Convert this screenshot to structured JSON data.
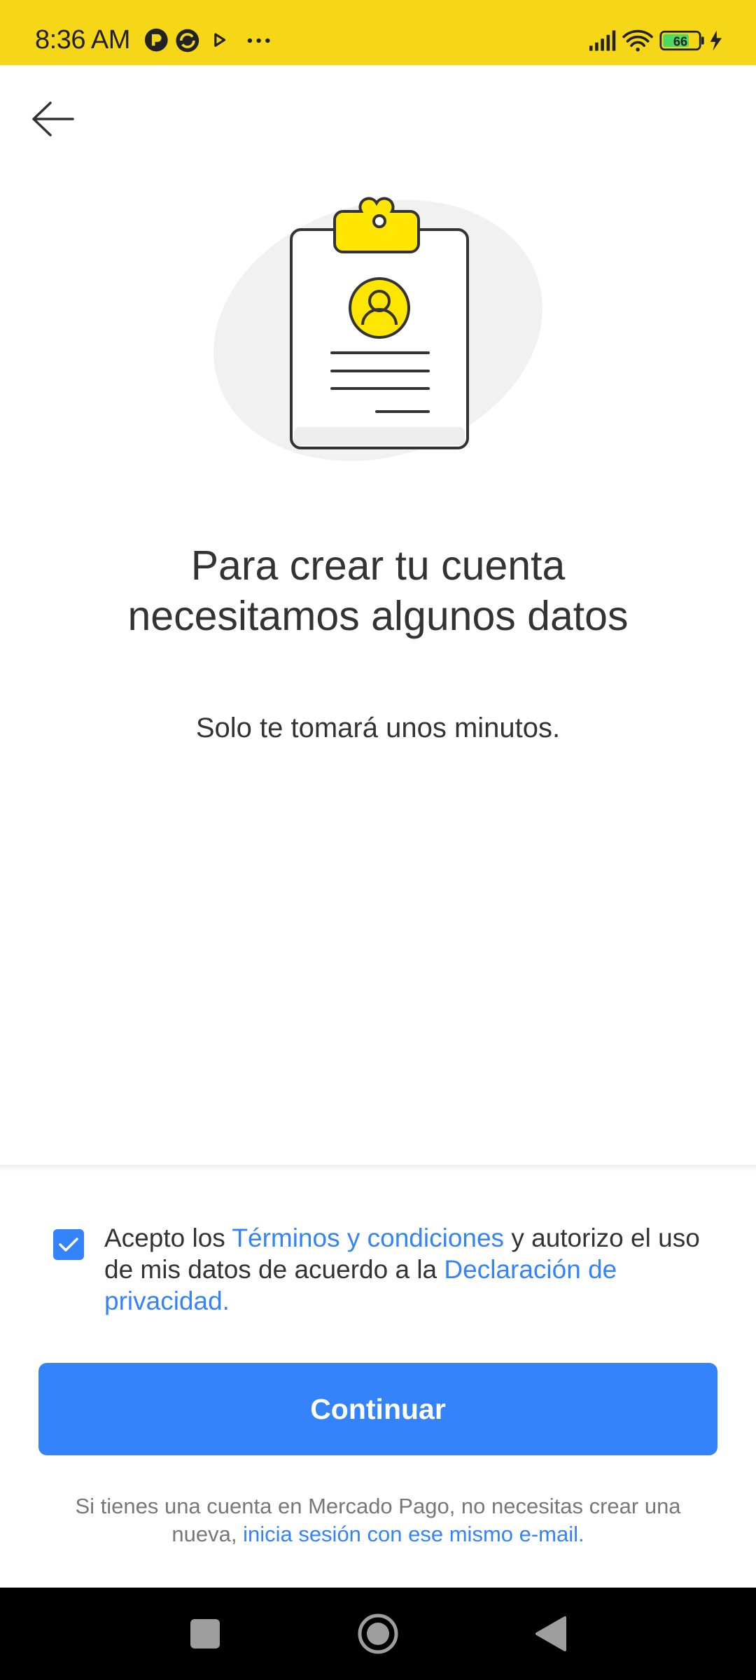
{
  "status_bar": {
    "time": "8:36 AM",
    "battery_level": "66",
    "icons": [
      "notification-icon",
      "sync-icon",
      "play-icon",
      "more-icon",
      "signal-icon",
      "wifi-icon",
      "battery-icon",
      "charging-icon"
    ]
  },
  "header": {
    "back_icon": "arrow-left-icon"
  },
  "main": {
    "illustration": "clipboard-profile-illustration",
    "title_line1": "Para crear tu cuenta",
    "title_line2": "necesitamos algunos datos",
    "subtitle": "Solo te tomará unos minutos."
  },
  "consent": {
    "checked": true,
    "text_before_terms": "Acepto los ",
    "terms_link": "Términos y condiciones",
    "text_middle": " y autorizo el uso de mis datos de acuerdo a la ",
    "privacy_link": "Declaración de privacidad."
  },
  "actions": {
    "continue_label": "Continuar"
  },
  "footer": {
    "note_text": "Si tienes una cuenta en Mercado Pago, no necesitas crear una nueva, ",
    "login_link": "inicia sesión con ese mismo e-mail."
  },
  "colors": {
    "brand_yellow": "#f6d718",
    "accent_blue": "#3483fa",
    "text_dark": "#333333",
    "text_muted": "#777777"
  }
}
